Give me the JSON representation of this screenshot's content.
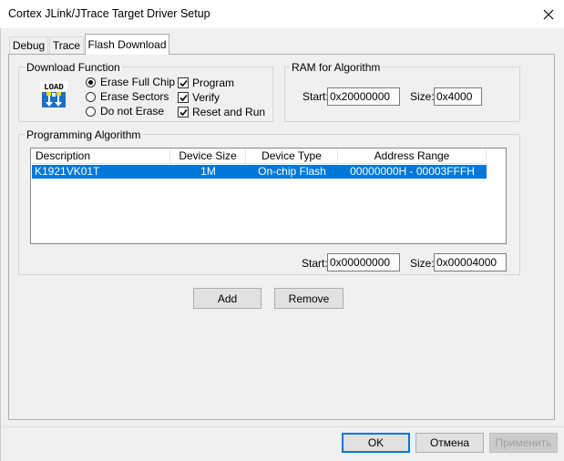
{
  "window": {
    "title": "Cortex JLink/JTrace Target Driver Setup",
    "close_icon": "close-icon"
  },
  "tabs": [
    {
      "label": "Debug",
      "active": false
    },
    {
      "label": "Trace",
      "active": false
    },
    {
      "label": "Flash Download",
      "active": true
    }
  ],
  "download_function": {
    "legend": "Download Function",
    "icon": "load-icon",
    "icon_text": "LOAD",
    "radios": [
      {
        "label": "Erase Full Chip",
        "checked": true
      },
      {
        "label": "Erase Sectors",
        "checked": false
      },
      {
        "label": "Do not Erase",
        "checked": false
      }
    ],
    "checks": [
      {
        "label": "Program",
        "checked": true
      },
      {
        "label": "Verify",
        "checked": true
      },
      {
        "label": "Reset and Run",
        "checked": true
      }
    ]
  },
  "ram": {
    "legend": "RAM for Algorithm",
    "start_label": "Start:",
    "start_value": "0x20000000",
    "size_label": "Size:",
    "size_value": "0x4000"
  },
  "programming_algorithm": {
    "legend": "Programming Algorithm",
    "columns": [
      "Description",
      "Device Size",
      "Device Type",
      "Address Range"
    ],
    "rows": [
      {
        "description": "K1921VK01T",
        "device_size": "1M",
        "device_type": "On-chip Flash",
        "address_range": "00000000H - 00003FFFH",
        "selected": true
      }
    ],
    "start_label": "Start:",
    "start_value": "0x00000000",
    "size_label": "Size:",
    "size_value": "0x00004000"
  },
  "buttons": {
    "add": "Add",
    "remove": "Remove",
    "ok": "OK",
    "cancel": "Отмена",
    "apply": "Применить"
  },
  "colors": {
    "selection": "#0078d7",
    "window_bg": "#f0f0f0"
  }
}
